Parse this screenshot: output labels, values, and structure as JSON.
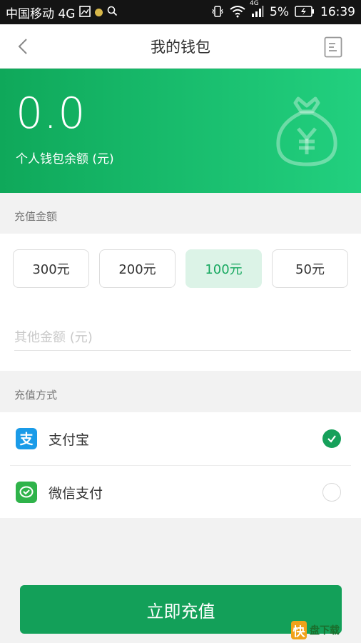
{
  "status_bar": {
    "carrier": "中国移动 4G",
    "battery": "5%",
    "time": "16:39",
    "network_badge": "4G"
  },
  "nav": {
    "title": "我的钱包",
    "back_icon": "chevron-left-icon",
    "bill_icon": "document-list-icon"
  },
  "wallet": {
    "balance": "0.0",
    "balance_label": "个人钱包余额 (元)",
    "illustration": "money-bag-yuan-icon"
  },
  "recharge": {
    "section_label": "充值金额",
    "options": [
      "300元",
      "200元",
      "100元",
      "50元"
    ],
    "selected_index": 2,
    "other_placeholder": "其他金额 (元)"
  },
  "payment": {
    "section_label": "充值方式",
    "methods": [
      {
        "label": "支付宝",
        "icon": "alipay-icon",
        "checked": true
      },
      {
        "label": "微信支付",
        "icon": "wechat-pay-icon",
        "checked": false
      }
    ]
  },
  "submit": {
    "label": "立即充值"
  },
  "watermark": {
    "text": "盘下载"
  },
  "colors": {
    "primary": "#13a059",
    "hero_start": "#0fa85a",
    "hero_end": "#22d07f",
    "selected_bg": "#dcf3e7"
  }
}
